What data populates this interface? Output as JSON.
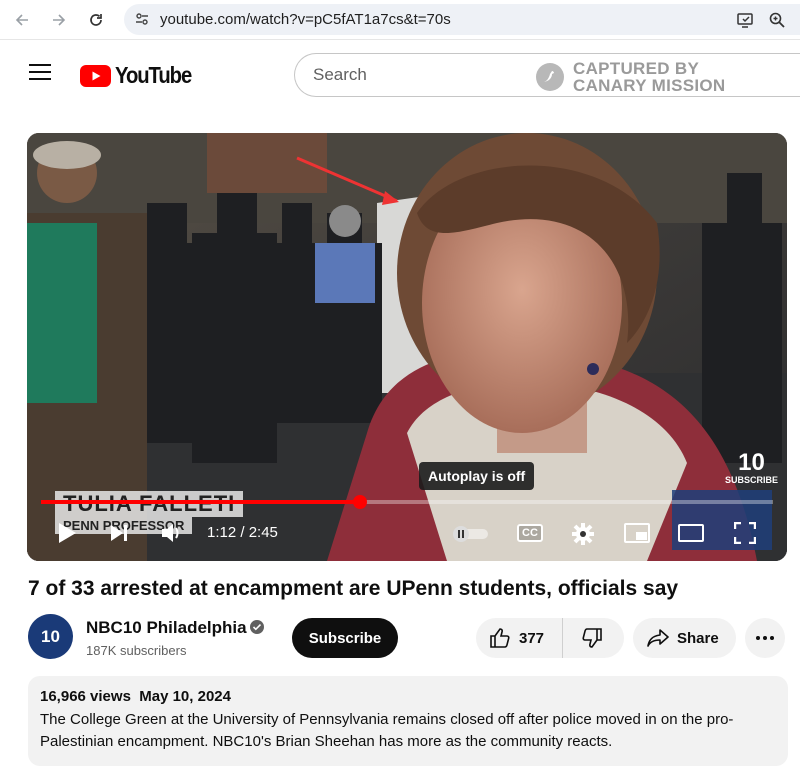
{
  "browser": {
    "url": "youtube.com/watch?v=pC5fAT1a7cs&t=70s"
  },
  "header": {
    "logo_text": "YouTube",
    "search_placeholder": "Search",
    "watermark_line1": "CAPTURED BY",
    "watermark_line2": "CANARY MISSION"
  },
  "player": {
    "tooltip": "Autoplay is off",
    "time": "1:12 / 2:45",
    "progress_fraction": 0.436,
    "lower_third_name": "TULIA FALLETI",
    "lower_third_title": "PENN PROFESSOR",
    "badge_number": "10",
    "badge_subscribe": "SUBSCRIBE",
    "cc_label": "CC"
  },
  "video": {
    "title": "7 of 33 arrested at encampment are UPenn students, officials say"
  },
  "channel": {
    "avatar_text": "10",
    "name": "NBC10 Philadelphia",
    "subscribers": "187K subscribers",
    "subscribe_label": "Subscribe"
  },
  "actions": {
    "likes": "377",
    "share_label": "Share"
  },
  "description": {
    "meta": "16,966 views  May 10, 2024",
    "text": "The College Green at the University of Pennsylvania remains closed off after police moved in on the pro-Palestinian encampment. NBC10's Brian Sheehan has more as the community reacts."
  },
  "colors": {
    "brand_red": "#ff0000",
    "pill_bg": "#f2f2f2",
    "subscribe_bg": "#0f0f0f"
  }
}
